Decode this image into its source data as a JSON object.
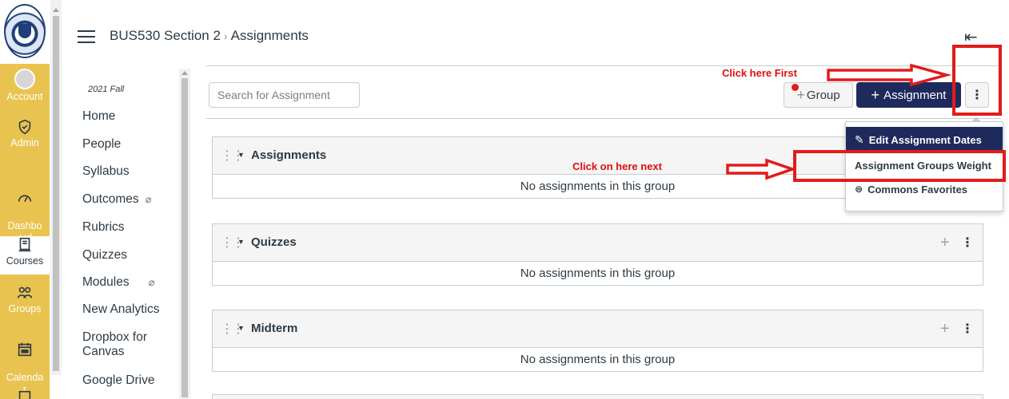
{
  "header": {
    "course": "BUS530 Section 2",
    "separator": "›",
    "page": "Assignments"
  },
  "global_nav": {
    "items": [
      {
        "label": "Account",
        "icon": "account-icon"
      },
      {
        "label": "Admin",
        "icon": "admin-shield-icon"
      },
      {
        "label": "Dashbo\nard",
        "icon": "dashboard-icon"
      },
      {
        "label": "Courses",
        "icon": "courses-icon",
        "active": true
      },
      {
        "label": "Groups",
        "icon": "groups-icon"
      },
      {
        "label": "Calenda\nr",
        "icon": "calendar-icon"
      }
    ]
  },
  "course_nav": {
    "term": "2021 Fall",
    "links": [
      {
        "label": "Home"
      },
      {
        "label": "People"
      },
      {
        "label": "Syllabus"
      },
      {
        "label": "Outcomes",
        "hidden_icon": true
      },
      {
        "label": "Rubrics"
      },
      {
        "label": "Quizzes"
      },
      {
        "label": "Modules",
        "hidden_icon": true
      },
      {
        "label": "New Analytics"
      },
      {
        "label": "Dropbox for\nCanvas"
      },
      {
        "label": "Google Drive"
      }
    ]
  },
  "toolbar": {
    "search_placeholder": "Search for Assignment",
    "group_button": "Group",
    "assignment_button": "Assignment",
    "plus": "+",
    "kebab": "⋮"
  },
  "menu": {
    "items": [
      {
        "label": "Edit Assignment Dates",
        "icon": "pencil-icon",
        "selected": true
      },
      {
        "label": "Assignment Groups Weight",
        "icon": "",
        "selected": false
      },
      {
        "label": "Commons Favorites",
        "icon": "commons-icon",
        "selected": false
      }
    ]
  },
  "groups": [
    {
      "title": "Assignments",
      "empty_text": "No assignments in this group"
    },
    {
      "title": "Quizzes",
      "empty_text": "No assignments in this group"
    },
    {
      "title": "Midterm",
      "empty_text": "No assignments in this group"
    }
  ],
  "annotations": {
    "first": "Click here First",
    "next": "Click on here next"
  },
  "colors": {
    "nav_rail": "#e9c34f",
    "primary_button": "#1f2a5c",
    "annotation_red": "#e21b1b"
  }
}
